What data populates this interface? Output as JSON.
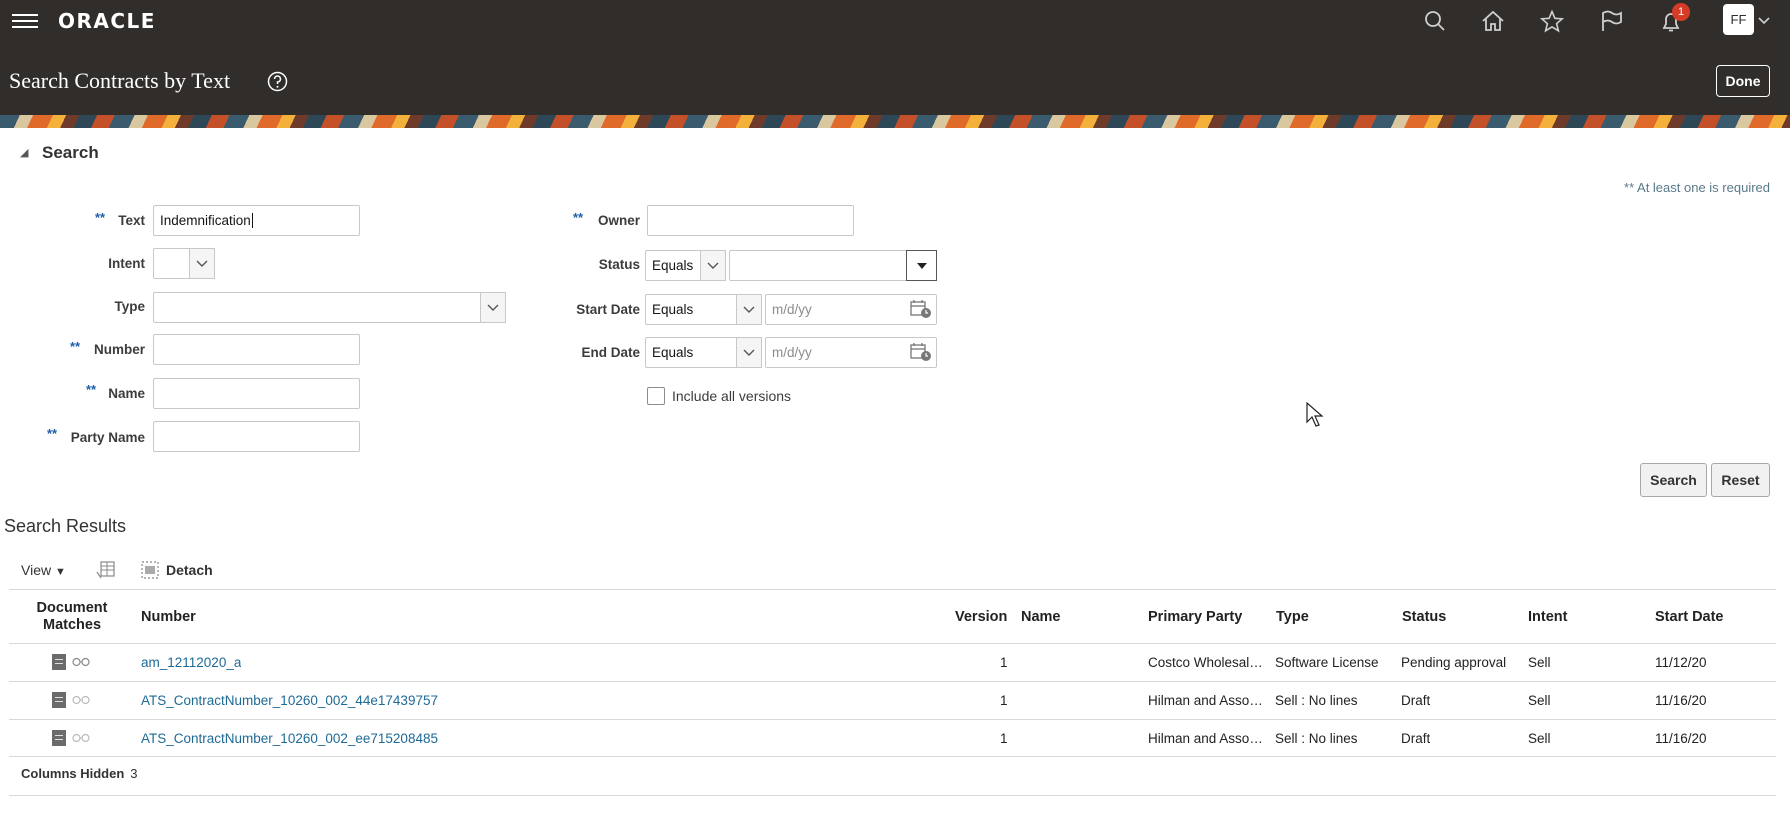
{
  "header": {
    "logo": "ORACLE",
    "page_title": "Search Contracts by Text",
    "done_label": "Done",
    "notifications_count": "1",
    "user_initials": "FF"
  },
  "search": {
    "section_title": "Search",
    "required_note": "** At least one is required",
    "required_marker": "**",
    "labels": {
      "text": "Text",
      "intent": "Intent",
      "type": "Type",
      "number": "Number",
      "name": "Name",
      "party_name": "Party Name",
      "owner": "Owner",
      "status": "Status",
      "start_date": "Start Date",
      "end_date": "End Date",
      "include_versions": "Include all versions"
    },
    "values": {
      "text": "Indemnification",
      "status_operator": "Equals",
      "start_date_operator": "Equals",
      "end_date_operator": "Equals"
    },
    "placeholders": {
      "start_date": "m/d/yy",
      "end_date": "m/d/yy"
    },
    "search_button": "Search",
    "reset_button": "Reset"
  },
  "results": {
    "title": "Search Results",
    "view_label": "View",
    "detach_label": "Detach",
    "columns": {
      "doc_matches_1": "Document",
      "doc_matches_2": "Matches",
      "number": "Number",
      "version": "Version",
      "name": "Name",
      "primary_party": "Primary Party",
      "type": "Type",
      "status": "Status",
      "intent": "Intent",
      "start_date": "Start Date"
    },
    "rows": [
      {
        "number": "am_12112020_a",
        "version": "1",
        "name": "",
        "primary_party": "Costco Wholesale Corporation",
        "type": "Software License",
        "status": "Pending approval",
        "intent": "Sell",
        "start_date": "11/12/20"
      },
      {
        "number": "ATS_ContractNumber_10260_002_44e17439757",
        "version": "1",
        "name": "",
        "primary_party": "Hilman and Associates",
        "type": "Sell : No lines",
        "status": "Draft",
        "intent": "Sell",
        "start_date": "11/16/20"
      },
      {
        "number": "ATS_ContractNumber_10260_002_ee715208485",
        "version": "1",
        "name": "",
        "primary_party": "Hilman and Associates",
        "type": "Sell : No lines",
        "status": "Draft",
        "intent": "Sell",
        "start_date": "11/16/20"
      }
    ],
    "columns_hidden_label": "Columns Hidden",
    "columns_hidden_count": "3"
  }
}
